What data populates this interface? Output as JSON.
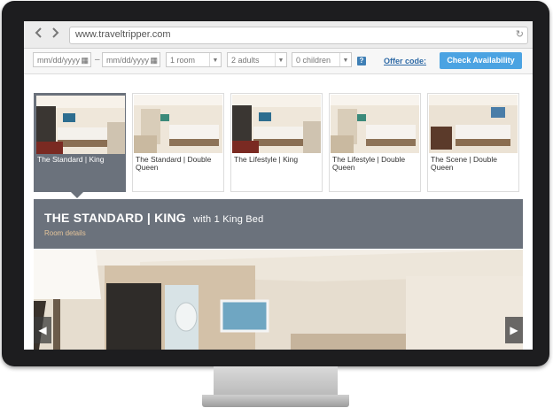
{
  "browser": {
    "url": "www.traveltripper.com",
    "back_icon": "arrow-left-icon",
    "forward_icon": "arrow-right-icon",
    "reload_icon": "reload-icon"
  },
  "booking": {
    "checkin_placeholder": "mm/dd/yyyy",
    "checkout_placeholder": "mm/dd/yyyy",
    "date_separator": "–",
    "rooms_value": "1 room",
    "adults_value": "2 adults",
    "children_value": "0 children",
    "help_label": "?",
    "offer_label": "Offer code:",
    "check_label": "Check Availability"
  },
  "rooms": [
    {
      "label": "The Standard | King",
      "active": true
    },
    {
      "label": "The Standard | Double Queen",
      "active": false
    },
    {
      "label": "The Lifestyle | King",
      "active": false
    },
    {
      "label": "The Lifestyle | Double Queen",
      "active": false
    },
    {
      "label": "The Scene | Double Queen",
      "active": false
    }
  ],
  "selected_room": {
    "title": "THE STANDARD | KING",
    "subtitle": "with 1 King Bed",
    "details_label": "Room details"
  },
  "colors": {
    "accent": "#4ba3e2",
    "band": "#6b727c",
    "link": "#2f6aa6"
  }
}
